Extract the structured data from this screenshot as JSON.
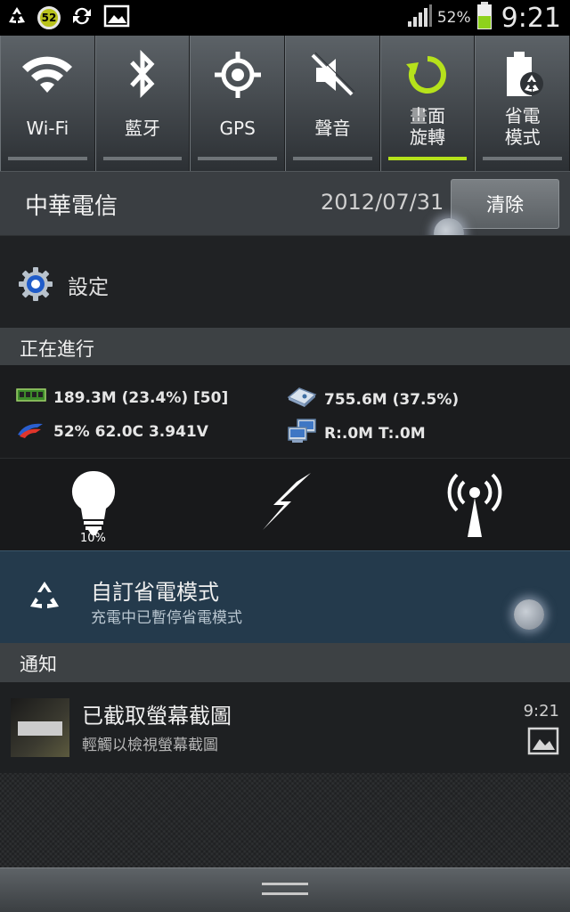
{
  "statusbar": {
    "notification_badge": "52",
    "battery_percent": "52%",
    "time": "9:21",
    "icons": [
      "recycle-icon",
      "badge-icon",
      "sync-icon",
      "image-icon",
      "signal-icon",
      "battery-icon"
    ]
  },
  "quick_toggles": [
    {
      "label": "Wi-Fi",
      "icon": "wifi-icon"
    },
    {
      "label": "藍牙",
      "icon": "bluetooth-icon"
    },
    {
      "label": "GPS",
      "icon": "gps-icon"
    },
    {
      "label": "聲音",
      "icon": "sound-muted-icon"
    },
    {
      "label_line1": "畫面",
      "label_line2": "旋轉",
      "icon": "rotate-icon",
      "active": true
    },
    {
      "label_line1": "省電",
      "label_line2": "模式",
      "icon": "power-saving-icon"
    }
  ],
  "carrier": {
    "name": "中華電信",
    "date": "2012/07/31",
    "clear_label": "清除"
  },
  "settings": {
    "label": "設定"
  },
  "ongoing": {
    "header": "正在進行",
    "ram": "189.3M (23.4%) [50]",
    "storage": "755.6M (37.5%)",
    "battery": "52% 62.0C 3.941V",
    "network": "R:.0M T:.0M",
    "brightness_percent": "10%"
  },
  "power_saving": {
    "title": "自訂省電模式",
    "subtitle": "充電中已暫停省電模式"
  },
  "notifications": {
    "header": "通知",
    "items": [
      {
        "title": "已截取螢幕截圖",
        "subtitle": "輕觸以檢視螢幕截圖",
        "time": "9:21"
      }
    ]
  },
  "colors": {
    "accent_green": "#b6e21b",
    "toggle_bg": "#3e4347",
    "powersave_bg": "#243a4c"
  }
}
